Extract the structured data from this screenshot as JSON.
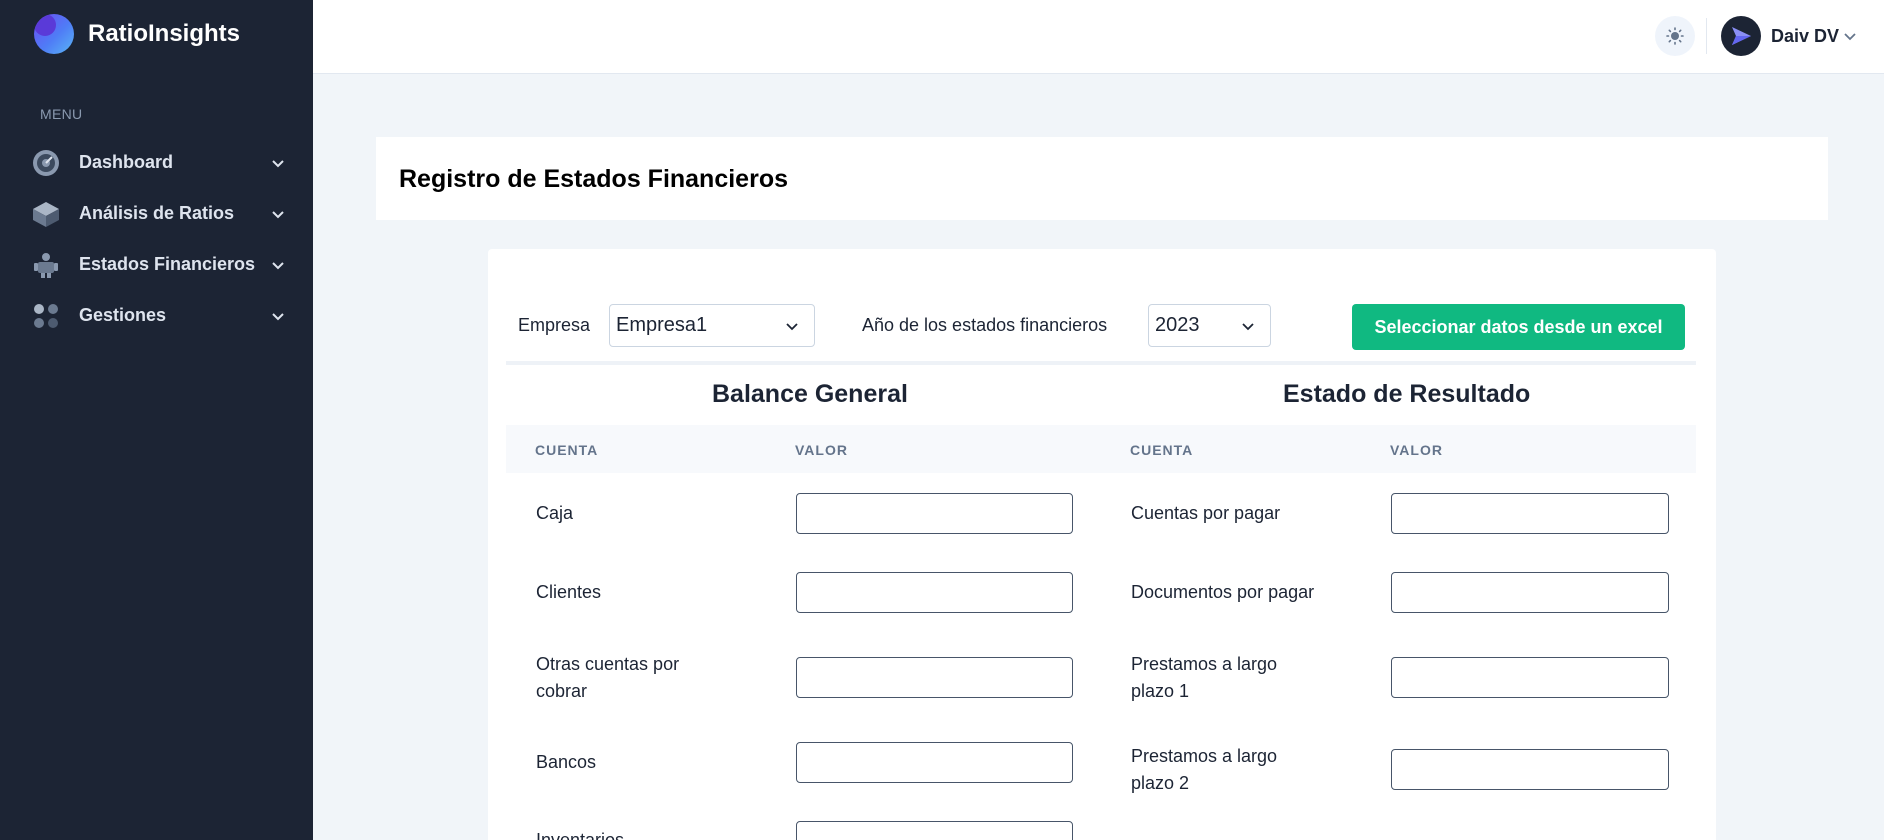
{
  "brand": {
    "name": "RatioInsights"
  },
  "sidebar": {
    "menu_heading": "MENU",
    "items": [
      {
        "label": "Dashboard",
        "icon": "dashboard-icon"
      },
      {
        "label": "Análisis de Ratios",
        "icon": "cube-icon"
      },
      {
        "label": "Estados Financieros",
        "icon": "person-icon"
      },
      {
        "label": "Gestiones",
        "icon": "dots-grid-icon"
      }
    ]
  },
  "header": {
    "theme_icon": "sun-icon",
    "user_name": "Daiv DV"
  },
  "page": {
    "title": "Registro de Estados Financieros"
  },
  "form": {
    "empresa_label": "Empresa",
    "empresa_value": "Empresa1",
    "anio_label": "Año de los estados financieros",
    "anio_value": "2023",
    "excel_button": "Seleccionar datos desde un excel"
  },
  "balance": {
    "title": "Balance General",
    "col_cuenta": "CUENTA",
    "col_valor": "VALOR",
    "rows": [
      {
        "cuenta": "Caja",
        "valor": ""
      },
      {
        "cuenta": "Clientes",
        "valor": ""
      },
      {
        "cuenta": "Otras cuentas por cobrar",
        "valor": ""
      },
      {
        "cuenta": "Bancos",
        "valor": ""
      },
      {
        "cuenta": "Inventarios",
        "valor": ""
      }
    ]
  },
  "resultado": {
    "title": "Estado de Resultado",
    "col_cuenta": "CUENTA",
    "col_valor": "VALOR",
    "rows": [
      {
        "cuenta": "Cuentas por pagar",
        "valor": ""
      },
      {
        "cuenta": "Documentos por pagar",
        "valor": ""
      },
      {
        "cuenta": "Prestamos a largo plazo 1",
        "valor": ""
      },
      {
        "cuenta": "Prestamos a largo plazo 2",
        "valor": ""
      }
    ]
  },
  "colors": {
    "sidebar_bg": "#1c2434",
    "accent_green": "#10b981",
    "page_bg": "#f1f5f9"
  }
}
